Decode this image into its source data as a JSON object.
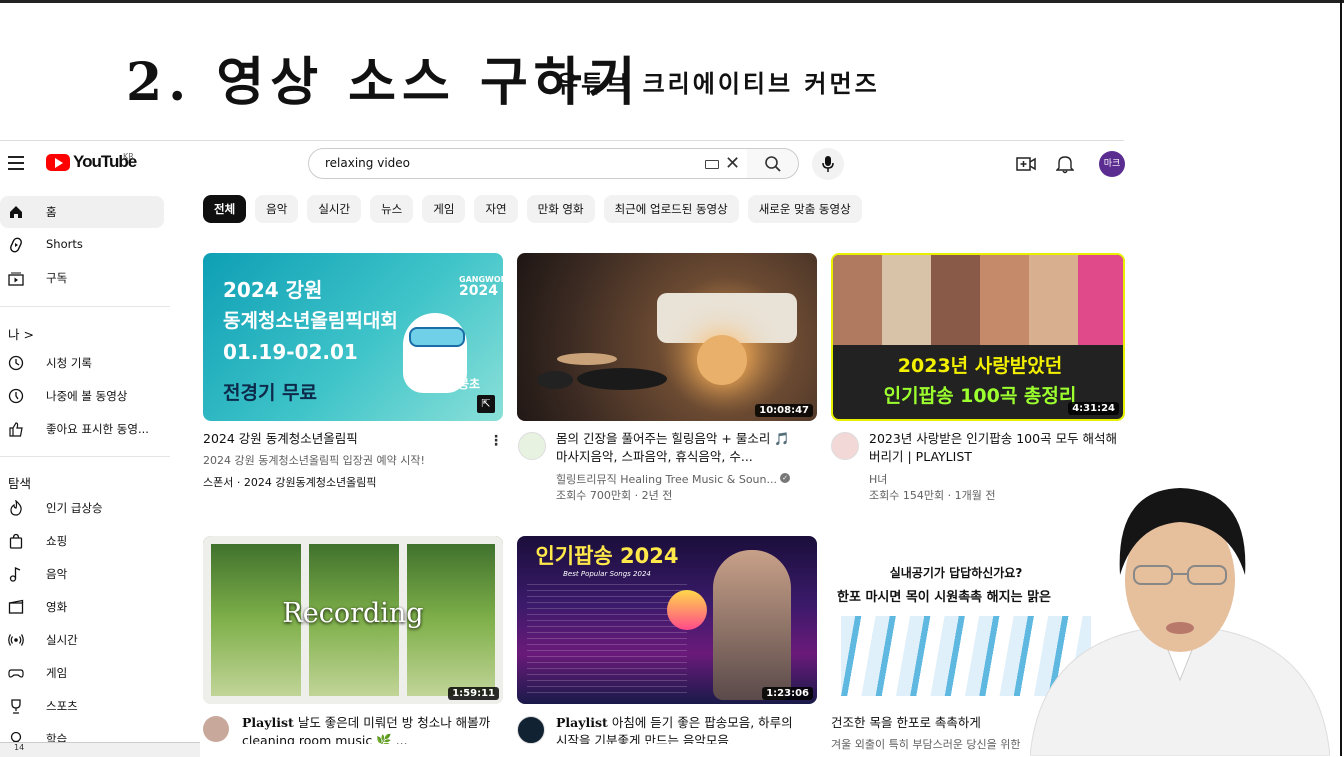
{
  "slide": {
    "title": "2. 영상 소스 구하기",
    "subtitle": "유튜브 크리에이티브 커먼즈"
  },
  "header": {
    "logo_text": "YouTube",
    "region": "KR",
    "search_value": "relaxing video",
    "avatar_text": "마크"
  },
  "sidebar": {
    "main": [
      {
        "label": "홈",
        "icon": "home-icon"
      },
      {
        "label": "Shorts",
        "icon": "shorts-icon"
      },
      {
        "label": "구독",
        "icon": "subscriptions-icon"
      }
    ],
    "you_header": "나 >",
    "you": [
      {
        "label": "시청 기록",
        "icon": "history-icon"
      },
      {
        "label": "나중에 볼 동영상",
        "icon": "watch-later-icon"
      },
      {
        "label": "좋아요 표시한 동영...",
        "icon": "thumbs-up-icon"
      }
    ],
    "explore_header": "탐색",
    "explore": [
      {
        "label": "인기 급상승",
        "icon": "trending-icon"
      },
      {
        "label": "쇼핑",
        "icon": "shopping-icon"
      },
      {
        "label": "음악",
        "icon": "music-icon"
      },
      {
        "label": "영화",
        "icon": "movie-icon"
      },
      {
        "label": "실시간",
        "icon": "live-icon"
      },
      {
        "label": "게임",
        "icon": "gaming-icon"
      },
      {
        "label": "스포츠",
        "icon": "sports-icon"
      },
      {
        "label": "학습",
        "icon": "learning-icon"
      }
    ]
  },
  "chips": [
    "전체",
    "음악",
    "실시간",
    "뉴스",
    "게임",
    "자연",
    "만화 영화",
    "최근에 업로드된 동영상",
    "새로운 맞춤 동영상"
  ],
  "videos": [
    {
      "thumb_lines": [
        "2024 강원",
        "동계청소년올림픽대회",
        "01.19-02.01",
        "전경기 무료"
      ],
      "thumb_badge_1": "GANGWON",
      "thumb_badge_2": "2024",
      "thumb_mascot": "뭉초",
      "title": "2024 강원 동계청소년올림픽",
      "desc": "2024 강원 동계청소년올림픽 입장권 예약 시작!",
      "meta": "스폰서 · 2024 강원동계청소년올림픽"
    },
    {
      "duration": "10:08:47",
      "title": "몸의 긴장을 풀어주는 힐링음악 + 물소리 🎵 마사지음악, 스파음악, 휴식음악, 수...",
      "channel": "힐링트리뮤직 Healing Tree Music & Soun...",
      "meta": "조회수 700만회 · 2년 전"
    },
    {
      "duration": "4:31:24",
      "thumb_line1": "2023년 사랑받았던",
      "thumb_line2": "인기팝송 100곡 총정리",
      "title": "2023년 사랑받은 인기팝송 100곡 모두 해석해버리기 | PLAYLIST",
      "channel": "H녀",
      "meta": "조회수 154만회 · 1개월 전"
    },
    {
      "duration": "1:59:11",
      "thumb_text": "Recording",
      "title_prefix": "Playlist",
      "title": "날도 좋은데 미뤄던 방 청소나 해볼까 cleaning room music 🌿 ..."
    },
    {
      "duration": "1:23:06",
      "thumb_title": "인기팝송 2024",
      "thumb_sub": "Best Popular Songs 2024",
      "title_prefix": "Playlist",
      "title": "아침에 듣기 좋은 팝송모음, 하루의 시작을 기분좋게 만드는 음악모음"
    },
    {
      "ad_line1": "실내공기가 답답하신가요?",
      "ad_line2": "한포 마시면 목이 시원촉촉 해지는 맑은",
      "title": "건조한 목을 한포로 촉촉하게",
      "desc": "겨울 외출이 특히 부담스러운 당신을 위한"
    }
  ],
  "taskbar_text": "14"
}
